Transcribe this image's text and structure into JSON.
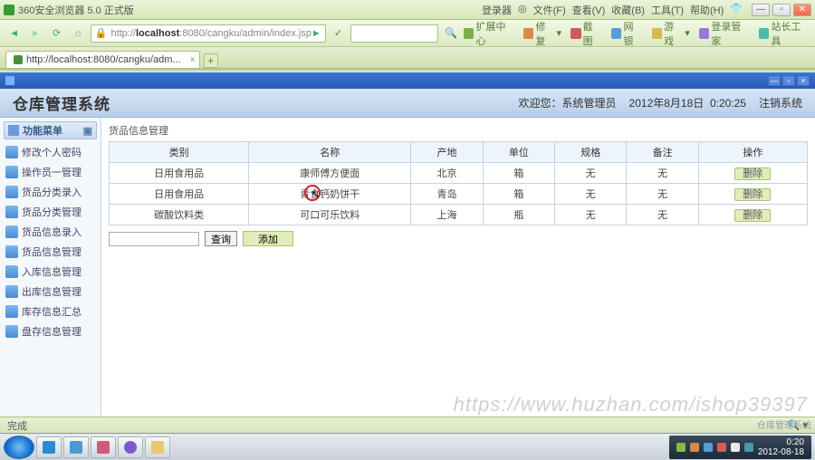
{
  "browser": {
    "title": "360安全浏览器 5.0 正式版",
    "menus": [
      "登录器",
      "文件(F)",
      "查看(V)",
      "收藏(B)",
      "工具(T)",
      "帮助(H)"
    ],
    "address_prefix": "http://",
    "address_host": "localhost",
    "address_rest": ":8080/cangku/admin/index.jsp",
    "toolbar": [
      "扩展中心",
      "修复",
      "截图",
      "网银",
      "游戏",
      "登录管家",
      "站长工具"
    ],
    "tab_label": "http://localhost:8080/cangku/adm..."
  },
  "inner_window": {
    "title": ""
  },
  "app": {
    "title": "仓库管理系统",
    "welcome": "欢迎您：系统管理员",
    "date": "2012年8月18日",
    "time": "0:20:25",
    "logout": "注销系统"
  },
  "sidebar": {
    "header": "功能菜单",
    "items": [
      "修改个人密码",
      "操作员一管理",
      "货品分类录入",
      "货品分类管理",
      "货品信息录入",
      "货品信息管理",
      "入库信息管理",
      "出库信息管理",
      "库存信息汇总",
      "盘存信息管理"
    ]
  },
  "panel": {
    "title": "货品信息管理",
    "columns": [
      "类别",
      "名称",
      "产地",
      "单位",
      "规格",
      "备注",
      "操作"
    ],
    "rows": [
      {
        "cat": "日用食用品",
        "name": "康师傅方便面",
        "place": "北京",
        "unit": "箱",
        "spec": "无",
        "note": "无",
        "op": "删除"
      },
      {
        "cat": "日用食用品",
        "name": "青食钙奶饼干",
        "place": "青岛",
        "unit": "箱",
        "spec": "无",
        "note": "无",
        "op": "删除"
      },
      {
        "cat": "碳酸饮料类",
        "name": "可口可乐饮料",
        "place": "上海",
        "unit": "瓶",
        "spec": "无",
        "note": "无",
        "op": "删除"
      }
    ],
    "query_btn": "查询",
    "add_btn": "添加"
  },
  "status": {
    "text": "完成"
  },
  "taskbar": {
    "time": "0:20",
    "date": "2012-08-18"
  },
  "watermark": "https://www.huzhan.com/ishop39397",
  "watermark2": "仓库管理系统"
}
